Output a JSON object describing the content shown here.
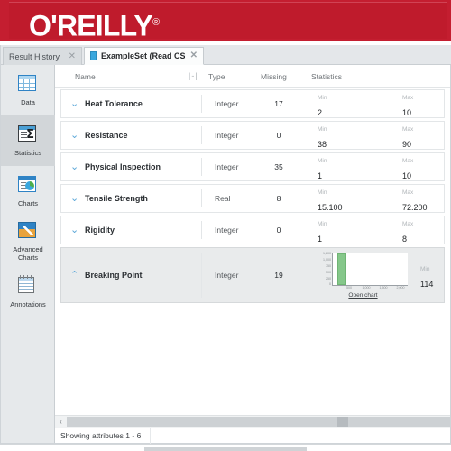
{
  "banner": {
    "brand": "O'REILLY",
    "registered": "®"
  },
  "tabs": [
    {
      "label": "Result History",
      "close": "✕",
      "active": false
    },
    {
      "label": "ExampleSet (Read CSV)",
      "close": "✕",
      "active": true
    }
  ],
  "sidebar": {
    "items": [
      {
        "label": "Data",
        "icon": "table-icon",
        "selected": false
      },
      {
        "label": "Statistics",
        "icon": "sigma-statistics-icon",
        "selected": true
      },
      {
        "label": "Charts",
        "icon": "pie-chart-icon",
        "selected": false
      },
      {
        "label": "Advanced\nCharts",
        "label_line1": "Advanced",
        "label_line2": "Charts",
        "icon": "advanced-chart-icon",
        "selected": false
      },
      {
        "label": "Annotations",
        "icon": "annotations-icon",
        "selected": false
      }
    ]
  },
  "table": {
    "headers": {
      "name": "Name",
      "sort_icon": "|-|",
      "type": "Type",
      "missing": "Missing",
      "statistics": "Statistics"
    },
    "rows": [
      {
        "name": "Heat Tolerance",
        "type": "Integer",
        "missing": "17",
        "stats": [
          {
            "label": "Min",
            "value": "2"
          },
          {
            "label": "Max",
            "value": "10"
          }
        ],
        "expanded": false,
        "chevron": "⌄"
      },
      {
        "name": "Resistance",
        "type": "Integer",
        "missing": "0",
        "stats": [
          {
            "label": "Min",
            "value": "38"
          },
          {
            "label": "Max",
            "value": "90"
          }
        ],
        "expanded": false,
        "chevron": "⌄"
      },
      {
        "name": "Physical Inspection",
        "type": "Integer",
        "missing": "35",
        "stats": [
          {
            "label": "Min",
            "value": "1"
          },
          {
            "label": "Max",
            "value": "10"
          }
        ],
        "expanded": false,
        "chevron": "⌄"
      },
      {
        "name": "Tensile Strength",
        "type": "Real",
        "missing": "8",
        "stats": [
          {
            "label": "Min",
            "value": "15.100"
          },
          {
            "label": "Max",
            "value": "72.200"
          }
        ],
        "expanded": false,
        "chevron": "⌄"
      },
      {
        "name": "Rigidity",
        "type": "Integer",
        "missing": "0",
        "stats": [
          {
            "label": "Min",
            "value": "1"
          },
          {
            "label": "Max",
            "value": "8"
          }
        ],
        "expanded": false,
        "chevron": "⌄"
      },
      {
        "name": "Breaking Point",
        "type": "Integer",
        "missing": "19",
        "stats": [
          {
            "label": "Min",
            "value": "114"
          }
        ],
        "expanded": true,
        "chevron": "⌃",
        "open_chart_label": "Open chart"
      }
    ]
  },
  "chart_data": {
    "type": "bar",
    "title": "",
    "xlabel": "",
    "ylabel": "",
    "categories": [
      "500"
    ],
    "values": [
      1200
    ],
    "ylim": [
      0,
      1200
    ],
    "yticks": [
      "1,200",
      "1,000",
      "750",
      "500",
      "250",
      "0"
    ],
    "xticks": [
      "500",
      "1,000",
      "1,500",
      "2,000"
    ],
    "bar_color": "#85c78a",
    "grid": false,
    "legend": "none"
  },
  "scrollbar": {
    "left_arrow": "‹"
  },
  "status": {
    "text": "Showing attributes 1 - 6"
  },
  "colors": {
    "brand_red": "#c41e30",
    "accent_blue": "#5ba7d8",
    "bar_green": "#85c78a",
    "selected_row_bg": "#e9ebec"
  }
}
